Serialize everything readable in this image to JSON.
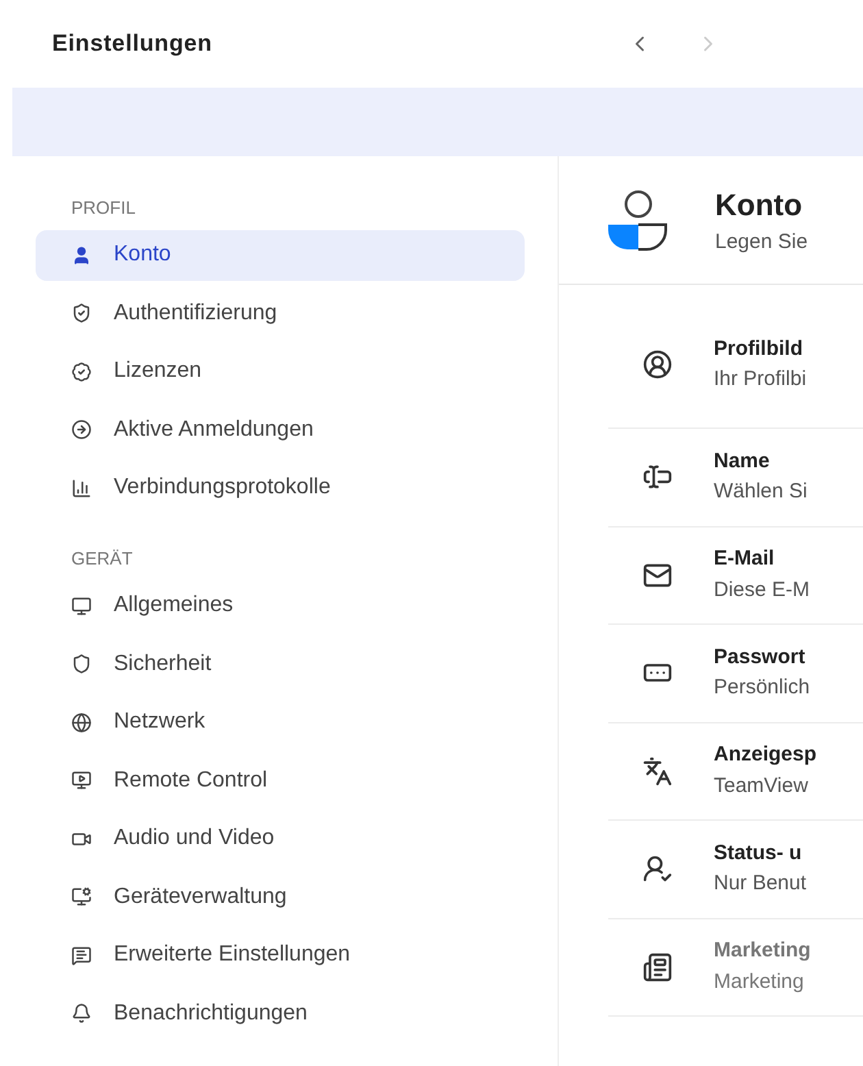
{
  "window": {
    "title": "Einstellungen"
  },
  "nav": {
    "forward_disabled": true
  },
  "sidebar": {
    "sections": [
      {
        "label": "PROFIL",
        "items": [
          {
            "label": "Konto",
            "selected": true
          },
          {
            "label": "Authentifizierung",
            "selected": false
          },
          {
            "label": "Lizenzen",
            "selected": false
          },
          {
            "label": "Aktive Anmeldungen",
            "selected": false
          },
          {
            "label": "Verbindungsprotokolle",
            "selected": false
          }
        ]
      },
      {
        "label": "GERÄT",
        "items": [
          {
            "label": "Allgemeines",
            "selected": false
          },
          {
            "label": "Sicherheit",
            "selected": false
          },
          {
            "label": "Netzwerk",
            "selected": false
          },
          {
            "label": "Remote Control",
            "selected": false
          },
          {
            "label": "Audio und Video",
            "selected": false
          },
          {
            "label": "Geräteverwaltung",
            "selected": false
          },
          {
            "label": "Erweiterte Einstellungen",
            "selected": false
          },
          {
            "label": "Benachrichtigungen",
            "selected": false
          }
        ]
      }
    ]
  },
  "content": {
    "title": "Konto",
    "subtitle": "Legen Sie",
    "rows": [
      {
        "title": "Profilbild",
        "description": "Ihr Profilbi",
        "disabled": false
      },
      {
        "title": "Name",
        "description": "Wählen Si",
        "disabled": false
      },
      {
        "title": "E-Mail",
        "description": "Diese E-M",
        "disabled": false
      },
      {
        "title": "Passwort",
        "description": "Persönlich",
        "disabled": false
      },
      {
        "title": "Anzeigesp",
        "description": "TeamView",
        "disabled": false
      },
      {
        "title": "Status- u",
        "description": "Nur Benut",
        "disabled": false
      },
      {
        "title": "Marketing",
        "description": "Marketing",
        "disabled": true
      }
    ]
  }
}
